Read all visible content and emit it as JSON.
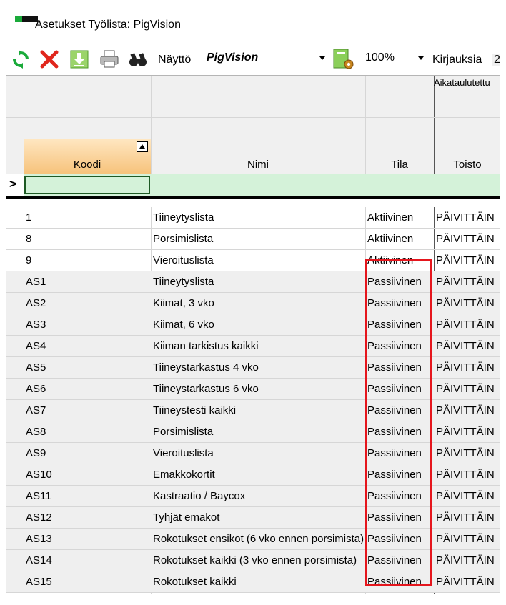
{
  "window": {
    "title": "Asetukset Työlista: PigVision"
  },
  "toolbar": {
    "display_label": "Näyttö",
    "display_value": "PigVision",
    "zoom_value": "100%",
    "records_label": "Kirjauksia",
    "records_value": "2"
  },
  "grid": {
    "group_header": "Aikataulutettu",
    "columns": [
      "Koodi",
      "Nimi",
      "Tila",
      "Toisto"
    ],
    "filter_indicator": ">",
    "rows": [
      {
        "koodi": "1",
        "nimi": "Tiineytyslista",
        "tila": "Aktiivinen",
        "toisto": "PÄIVITTÄIN"
      },
      {
        "koodi": "8",
        "nimi": "Porsimislista",
        "tila": "Aktiivinen",
        "toisto": "PÄIVITTÄIN"
      },
      {
        "koodi": "9",
        "nimi": "Vieroituslista",
        "tila": "Aktiivinen",
        "toisto": "PÄIVITTÄIN"
      },
      {
        "koodi": "AS1",
        "nimi": "Tiineytyslista",
        "tila": "Passiivinen",
        "toisto": "PÄIVITTÄIN"
      },
      {
        "koodi": "AS2",
        "nimi": "Kiimat, 3 vko",
        "tila": "Passiivinen",
        "toisto": "PÄIVITTÄIN"
      },
      {
        "koodi": "AS3",
        "nimi": "Kiimat, 6 vko",
        "tila": "Passiivinen",
        "toisto": "PÄIVITTÄIN"
      },
      {
        "koodi": "AS4",
        "nimi": "Kiiman tarkistus kaikki",
        "tila": "Passiivinen",
        "toisto": "PÄIVITTÄIN"
      },
      {
        "koodi": "AS5",
        "nimi": "Tiineystarkastus 4 vko",
        "tila": "Passiivinen",
        "toisto": "PÄIVITTÄIN"
      },
      {
        "koodi": "AS6",
        "nimi": "Tiineystarkastus 6 vko",
        "tila": "Passiivinen",
        "toisto": "PÄIVITTÄIN"
      },
      {
        "koodi": "AS7",
        "nimi": "Tiineystesti kaikki",
        "tila": "Passiivinen",
        "toisto": "PÄIVITTÄIN"
      },
      {
        "koodi": "AS8",
        "nimi": "Porsimislista",
        "tila": "Passiivinen",
        "toisto": "PÄIVITTÄIN"
      },
      {
        "koodi": "AS9",
        "nimi": "Vieroituslista",
        "tila": "Passiivinen",
        "toisto": "PÄIVITTÄIN"
      },
      {
        "koodi": "AS10",
        "nimi": "Emakkokortit",
        "tila": "Passiivinen",
        "toisto": "PÄIVITTÄIN"
      },
      {
        "koodi": "AS11",
        "nimi": "Kastraatio / Baycox",
        "tila": "Passiivinen",
        "toisto": "PÄIVITTÄIN"
      },
      {
        "koodi": "AS12",
        "nimi": "Tyhjät emakot",
        "tila": "Passiivinen",
        "toisto": "PÄIVITTÄIN"
      },
      {
        "koodi": "AS13",
        "nimi": "Rokotukset ensikot (6 vko ennen porsimista)",
        "tila": "Passiivinen",
        "toisto": "PÄIVITTÄIN"
      },
      {
        "koodi": "AS14",
        "nimi": "Rokotukset kaikki (3 vko ennen porsimista)",
        "tila": "Passiivinen",
        "toisto": "PÄIVITTÄIN"
      },
      {
        "koodi": "AS15",
        "nimi": "Rokotukset kaikki",
        "tila": "Passiivinen",
        "toisto": "PÄIVITTÄIN"
      }
    ]
  },
  "colors": {
    "highlight": "#e5161d",
    "sorted_header": "#f6c27a",
    "filter_row": "#d4f2d9",
    "icon_green": "#1aaa3a",
    "icon_red": "#e0261c"
  },
  "icons": [
    "refresh-icon",
    "delete-icon",
    "download-icon",
    "print-icon",
    "binoculars-icon",
    "settings-gear-icon"
  ]
}
